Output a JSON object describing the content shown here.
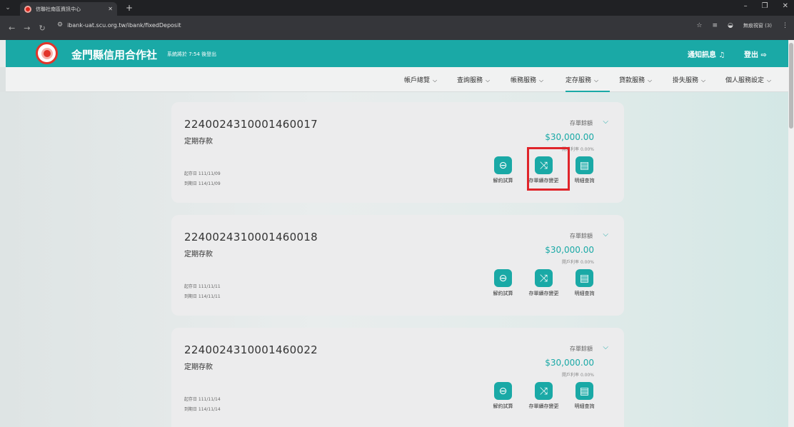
{
  "browser": {
    "tab_title": "信聯社南區資訊中心",
    "url": "ibank-uat.scu.org.tw/ibank/fixedDeposit",
    "profile_label": "無痕視窗 (3)"
  },
  "header": {
    "bank_name": "金門縣信用合作社",
    "logout_timer": "系統將於 7:54 後登出",
    "notifications_label": "通知訊息",
    "logout_label": "登出"
  },
  "nav": {
    "items": [
      {
        "label": "帳戶總覽"
      },
      {
        "label": "查詢服務"
      },
      {
        "label": "帳務服務"
      },
      {
        "label": "定存服務"
      },
      {
        "label": "貸款服務"
      },
      {
        "label": "掛失服務"
      },
      {
        "label": "個人服務設定"
      }
    ],
    "active": "定存服務"
  },
  "deposits": [
    {
      "account_no": "2240024310001460017",
      "type": "定期存款",
      "balance_label": "存單餘額",
      "balance": "$30,000.00",
      "rate": "開戶利率 0.00%",
      "start_date": "起存日 111/11/09",
      "end_date": "到期日 114/11/09"
    },
    {
      "account_no": "2240024310001460018",
      "type": "定期存款",
      "balance_label": "存單餘額",
      "balance": "$30,000.00",
      "rate": "開戶利率 0.00%",
      "start_date": "起存日 111/11/11",
      "end_date": "到期日 114/11/11"
    },
    {
      "account_no": "2240024310001460022",
      "type": "定期存款",
      "balance_label": "存單餘額",
      "balance": "$30,000.00",
      "rate": "開戶利率 0.00%",
      "start_date": "起存日 111/11/14",
      "end_date": "到期日 114/11/14"
    }
  ],
  "actions": {
    "terminate": "解約試算",
    "renewal": "存單續存變更",
    "details": "明細查詢"
  },
  "colors": {
    "brand": "#1aa9a6",
    "highlight": "#e0242a"
  }
}
